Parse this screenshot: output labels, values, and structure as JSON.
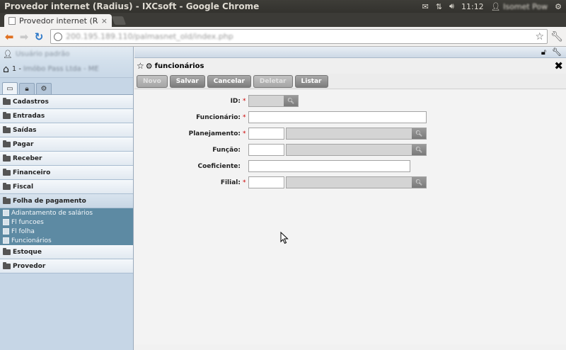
{
  "os": {
    "window_title": "Provedor internet (Radius) - IXCsoft - Google Chrome",
    "time": "11:12",
    "user": "Isomet Pow"
  },
  "browser": {
    "tab_title": "Provedor internet (Radius",
    "tab_close": "×",
    "url": "200.195.189.110/palmasnet_old/index.php"
  },
  "sidebar": {
    "user_label": "Usuário padrão",
    "unit_number": "1 -",
    "unit_name": "Imóbo Pass Ltda - ME",
    "menu": [
      {
        "label": "Cadastros"
      },
      {
        "label": "Entradas"
      },
      {
        "label": "Saídas"
      },
      {
        "label": "Pagar"
      },
      {
        "label": "Receber"
      },
      {
        "label": "Financeiro"
      },
      {
        "label": "Fiscal"
      },
      {
        "label": "Folha de pagamento"
      }
    ],
    "submenu": [
      {
        "label": "Adiantamento de salários"
      },
      {
        "label": "Fl funcoes"
      },
      {
        "label": "Fl folha"
      },
      {
        "label": "Funcionários"
      }
    ],
    "menu_after": [
      {
        "label": "Estoque"
      },
      {
        "label": "Provedor"
      }
    ]
  },
  "window": {
    "title": "funcionários",
    "close": "✖"
  },
  "toolbar": {
    "novo": "Novo",
    "salvar": "Salvar",
    "cancelar": "Cancelar",
    "deletar": "Deletar",
    "listar": "Listar"
  },
  "form": {
    "id_label": "ID:",
    "funcionario_label": "Funcionário:",
    "planejamento_label": "Planejamento:",
    "funcao_label": "Função:",
    "coeficiente_label": "Coeficiente:",
    "filial_label": "Filial:",
    "required_mark": "*"
  }
}
